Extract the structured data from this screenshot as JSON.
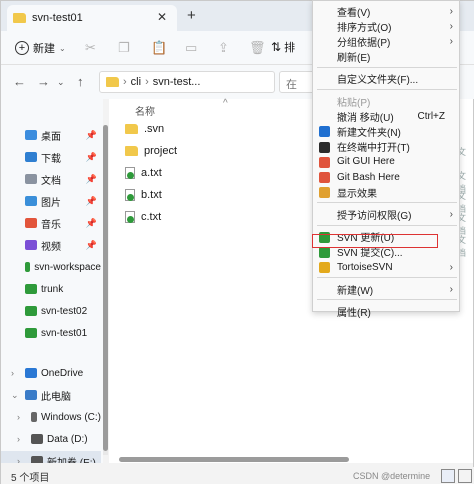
{
  "tab": {
    "title": "svn-test01",
    "close": "✕",
    "add": "+"
  },
  "toolbar": {
    "new_label": "新建",
    "sort_label": "排"
  },
  "address": {
    "path": [
      "cli",
      "svn-test..."
    ],
    "search_placeholder": "在"
  },
  "sidebar": {
    "items": [
      {
        "label": "桌面",
        "icon": "desktop-icon",
        "color": "#3c8dde",
        "pinned": true
      },
      {
        "label": "下载",
        "icon": "download-icon",
        "color": "#2f7fd1",
        "pinned": true
      },
      {
        "label": "文档",
        "icon": "document-icon",
        "color": "#8a93a0",
        "pinned": true
      },
      {
        "label": "图片",
        "icon": "pictures-icon",
        "color": "#3a8fd9",
        "pinned": true
      },
      {
        "label": "音乐",
        "icon": "music-icon",
        "color": "#e2553b",
        "pinned": true
      },
      {
        "label": "视频",
        "icon": "video-icon",
        "color": "#7b4fd6",
        "pinned": true
      },
      {
        "label": "svn-workspace",
        "icon": "svn-folder-icon",
        "color": "#2e9a3a",
        "pinned": false
      },
      {
        "label": "trunk",
        "icon": "svn-folder-icon",
        "color": "#2e9a3a",
        "pinned": false
      },
      {
        "label": "svn-test02",
        "icon": "svn-folder-icon",
        "color": "#2e9a3a",
        "pinned": false
      },
      {
        "label": "svn-test01",
        "icon": "svn-folder-icon",
        "color": "#2e9a3a",
        "pinned": false
      },
      {
        "label": "OneDrive",
        "icon": "cloud-icon",
        "color": "#2a78d4",
        "pinned": false
      },
      {
        "label": "此电脑",
        "icon": "computer-icon",
        "color": "#3a7cc8",
        "pinned": false
      },
      {
        "label": "Windows (C:)",
        "icon": "drive-icon",
        "color": "#666666",
        "pinned": false
      },
      {
        "label": "Data (D:)",
        "icon": "drive-icon",
        "color": "#555555",
        "pinned": false
      },
      {
        "label": "新加卷 (E:)",
        "icon": "drive-icon",
        "color": "#555555",
        "pinned": false
      }
    ]
  },
  "content": {
    "column_name": "名称",
    "files": [
      {
        "name": ".svn",
        "type": "folder"
      },
      {
        "name": "project",
        "type": "folder"
      },
      {
        "name": "a.txt",
        "type": "txt"
      },
      {
        "name": "b.txt",
        "type": "txt"
      },
      {
        "name": "c.txt",
        "type": "txt"
      }
    ]
  },
  "status": {
    "count": "5 个项目",
    "watermark": "CSDN @determine"
  },
  "right_hints": [
    "文",
    "文档",
    "文档",
    "文档",
    "文档"
  ],
  "menu": {
    "items": [
      {
        "label": "查看(V)",
        "arrow": true
      },
      {
        "label": "排序方式(O)",
        "arrow": true
      },
      {
        "label": "分组依据(P)",
        "arrow": true
      },
      {
        "label": "刷新(E)"
      },
      {
        "sep": true
      },
      {
        "label": "自定义文件夹(F)..."
      },
      {
        "sep": true
      },
      {
        "label": "粘贴(P)",
        "disabled": true
      },
      {
        "label": "撤消 移动(U)",
        "shortcut": "Ctrl+Z"
      },
      {
        "label": "新建文件夹(N)",
        "icon": "vscode-icon",
        "color": "#1f6fd0"
      },
      {
        "label": "在终端中打开(T)",
        "icon": "terminal-icon",
        "color": "#2b2b2b"
      },
      {
        "label": "Git GUI Here",
        "icon": "git-gui-icon",
        "color": "#e0543c"
      },
      {
        "label": "Git Bash Here",
        "icon": "git-bash-icon",
        "color": "#e0543c"
      },
      {
        "label": "显示效果",
        "icon": "display-effects-icon",
        "color": "#e0a030"
      },
      {
        "sep": true
      },
      {
        "label": "授予访问权限(G)",
        "arrow": true
      },
      {
        "sep": true
      },
      {
        "label": "SVN 更新(U)",
        "icon": "svn-update-icon",
        "color": "#2e9a3a"
      },
      {
        "label": "SVN 提交(C)...",
        "icon": "svn-commit-icon",
        "color": "#2e9a3a",
        "highlight": true
      },
      {
        "label": "TortoiseSVN",
        "icon": "tortoisesvn-icon",
        "color": "#e3a91c",
        "arrow": true
      },
      {
        "sep": true
      },
      {
        "label": "新建(W)",
        "arrow": true
      },
      {
        "sep": true
      },
      {
        "label": "属性(R)"
      }
    ]
  }
}
